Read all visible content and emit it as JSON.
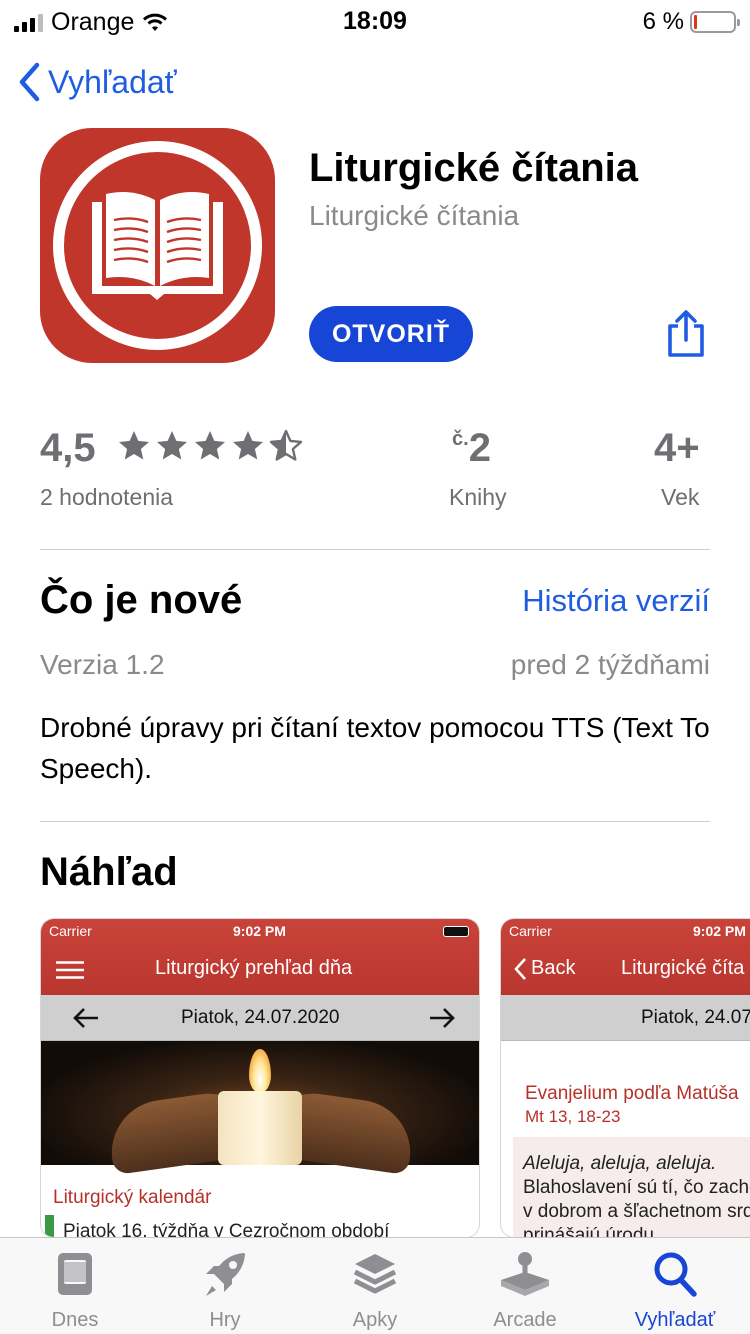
{
  "status": {
    "carrier": "Orange",
    "time": "18:09",
    "battery": "6 %"
  },
  "nav": {
    "back_label": "Vyhľadať"
  },
  "app": {
    "title": "Liturgické čítania",
    "subtitle": "Liturgické čítania",
    "open_label": "OTVORIŤ",
    "accent": "#1746d6",
    "icon_color": "#c0362b"
  },
  "stats": {
    "rating": "4,5",
    "stars": 4.5,
    "rating_label": "2 hodnotenia",
    "rank_prefix": "č.",
    "rank": "2",
    "rank_label": "Knihy",
    "age": "4+",
    "age_label": "Vek"
  },
  "whats_new": {
    "title": "Čo je nové",
    "history_link": "História verzií",
    "version": "Verzia 1.2",
    "date": "pred 2 týždňami",
    "notes": "Drobné úpravy pri čítaní textov pomocou TTS (Text To Speech)."
  },
  "preview": {
    "title": "Náhľad",
    "screens": [
      {
        "carrier": "Carrier",
        "time": "9:02 PM",
        "title": "Liturgický prehľad dňa",
        "date": "Piatok, 24.07.2020",
        "section": "Liturgický kalendár",
        "item": "Piatok 16. týždňa v Cezročnom období"
      },
      {
        "carrier": "Carrier",
        "time": "9:02 PM",
        "back": "Back",
        "title": "Liturgické číta",
        "date": "Piatok, 24.07",
        "heading": "Evanjelium podľa Matúša",
        "ref": "Mt 13, 18-23",
        "line1": "Aleluja, aleluja, aleluja.",
        "line2": "Blahoslavení sú tí, čo zacho",
        "line3": "v dobrom a šľachetnom srd",
        "line4": "prinášajú úrodu."
      }
    ]
  },
  "tabs": [
    {
      "label": "Dnes",
      "icon": "today-icon"
    },
    {
      "label": "Hry",
      "icon": "rocket-icon"
    },
    {
      "label": "Apky",
      "icon": "layers-icon"
    },
    {
      "label": "Arcade",
      "icon": "joystick-icon"
    },
    {
      "label": "Vyhľadať",
      "icon": "search-icon",
      "active": true
    }
  ]
}
